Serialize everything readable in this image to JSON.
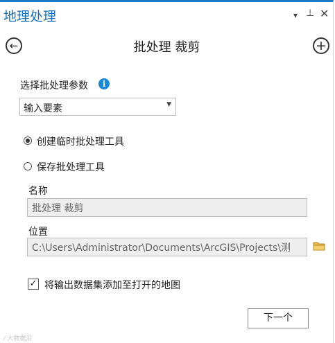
{
  "pane": {
    "title": "地理处理",
    "controls": {
      "menu": "▾",
      "pin": "⊥",
      "close": "✕"
    }
  },
  "nav": {
    "back_icon": "←",
    "add_icon": "+",
    "tool_title": "批处理 裁剪"
  },
  "batch_param": {
    "label": "选择批处理参数",
    "info_icon": "i",
    "selected": "输入要素",
    "dropdown_arrow": "▼"
  },
  "mode": {
    "options": [
      {
        "label": "创建临时批处理工具",
        "selected": true
      },
      {
        "label": "保存批处理工具",
        "selected": false
      }
    ]
  },
  "save": {
    "name_label": "名称",
    "name_value": "批处理 裁剪",
    "location_label": "位置",
    "location_value": "C:\\Users\\Administrator\\Documents\\ArcGIS\\Projects\\测"
  },
  "add_output": {
    "checked_mark": "✓",
    "label": "将输出数据集添加至打开的地图"
  },
  "next_button": "下一个",
  "watermark": "⁄ 大数据沿",
  "colors": {
    "accent": "#1a6fb4",
    "info": "#1a86d6",
    "folder": "#e8b84a"
  }
}
